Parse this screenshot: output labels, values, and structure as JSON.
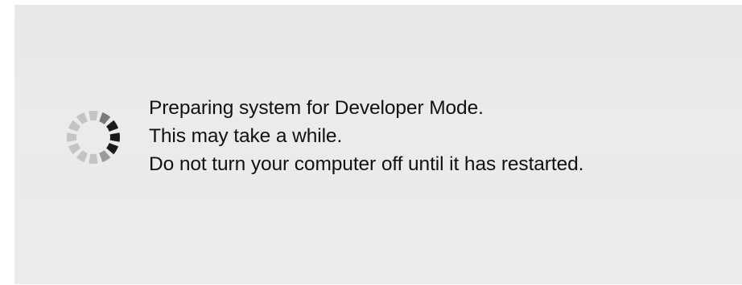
{
  "dialog": {
    "lines": [
      "Preparing system for Developer Mode.",
      "This may take a while.",
      "Do not turn your computer off until it has restarted."
    ]
  },
  "spinner": {
    "icon": "loading-spinner-icon",
    "colors": {
      "active": "#1a1a1a",
      "inactive": "#c4c4c4"
    }
  }
}
